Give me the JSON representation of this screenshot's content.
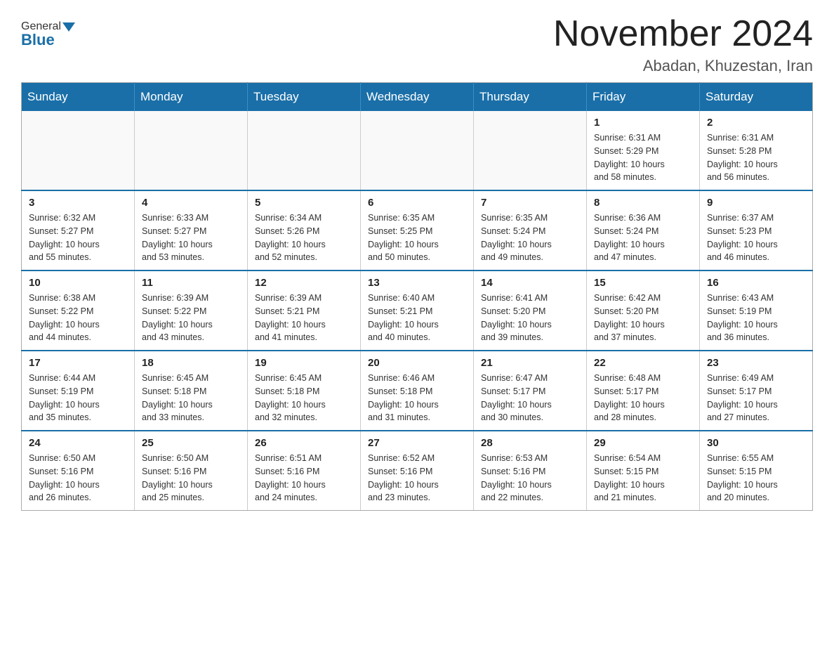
{
  "header": {
    "logo": {
      "general": "General",
      "blue": "Blue"
    },
    "title": "November 2024",
    "location": "Abadan, Khuzestan, Iran"
  },
  "weekdays": [
    "Sunday",
    "Monday",
    "Tuesday",
    "Wednesday",
    "Thursday",
    "Friday",
    "Saturday"
  ],
  "weeks": [
    [
      {
        "day": "",
        "info": ""
      },
      {
        "day": "",
        "info": ""
      },
      {
        "day": "",
        "info": ""
      },
      {
        "day": "",
        "info": ""
      },
      {
        "day": "",
        "info": ""
      },
      {
        "day": "1",
        "info": "Sunrise: 6:31 AM\nSunset: 5:29 PM\nDaylight: 10 hours\nand 58 minutes."
      },
      {
        "day": "2",
        "info": "Sunrise: 6:31 AM\nSunset: 5:28 PM\nDaylight: 10 hours\nand 56 minutes."
      }
    ],
    [
      {
        "day": "3",
        "info": "Sunrise: 6:32 AM\nSunset: 5:27 PM\nDaylight: 10 hours\nand 55 minutes."
      },
      {
        "day": "4",
        "info": "Sunrise: 6:33 AM\nSunset: 5:27 PM\nDaylight: 10 hours\nand 53 minutes."
      },
      {
        "day": "5",
        "info": "Sunrise: 6:34 AM\nSunset: 5:26 PM\nDaylight: 10 hours\nand 52 minutes."
      },
      {
        "day": "6",
        "info": "Sunrise: 6:35 AM\nSunset: 5:25 PM\nDaylight: 10 hours\nand 50 minutes."
      },
      {
        "day": "7",
        "info": "Sunrise: 6:35 AM\nSunset: 5:24 PM\nDaylight: 10 hours\nand 49 minutes."
      },
      {
        "day": "8",
        "info": "Sunrise: 6:36 AM\nSunset: 5:24 PM\nDaylight: 10 hours\nand 47 minutes."
      },
      {
        "day": "9",
        "info": "Sunrise: 6:37 AM\nSunset: 5:23 PM\nDaylight: 10 hours\nand 46 minutes."
      }
    ],
    [
      {
        "day": "10",
        "info": "Sunrise: 6:38 AM\nSunset: 5:22 PM\nDaylight: 10 hours\nand 44 minutes."
      },
      {
        "day": "11",
        "info": "Sunrise: 6:39 AM\nSunset: 5:22 PM\nDaylight: 10 hours\nand 43 minutes."
      },
      {
        "day": "12",
        "info": "Sunrise: 6:39 AM\nSunset: 5:21 PM\nDaylight: 10 hours\nand 41 minutes."
      },
      {
        "day": "13",
        "info": "Sunrise: 6:40 AM\nSunset: 5:21 PM\nDaylight: 10 hours\nand 40 minutes."
      },
      {
        "day": "14",
        "info": "Sunrise: 6:41 AM\nSunset: 5:20 PM\nDaylight: 10 hours\nand 39 minutes."
      },
      {
        "day": "15",
        "info": "Sunrise: 6:42 AM\nSunset: 5:20 PM\nDaylight: 10 hours\nand 37 minutes."
      },
      {
        "day": "16",
        "info": "Sunrise: 6:43 AM\nSunset: 5:19 PM\nDaylight: 10 hours\nand 36 minutes."
      }
    ],
    [
      {
        "day": "17",
        "info": "Sunrise: 6:44 AM\nSunset: 5:19 PM\nDaylight: 10 hours\nand 35 minutes."
      },
      {
        "day": "18",
        "info": "Sunrise: 6:45 AM\nSunset: 5:18 PM\nDaylight: 10 hours\nand 33 minutes."
      },
      {
        "day": "19",
        "info": "Sunrise: 6:45 AM\nSunset: 5:18 PM\nDaylight: 10 hours\nand 32 minutes."
      },
      {
        "day": "20",
        "info": "Sunrise: 6:46 AM\nSunset: 5:18 PM\nDaylight: 10 hours\nand 31 minutes."
      },
      {
        "day": "21",
        "info": "Sunrise: 6:47 AM\nSunset: 5:17 PM\nDaylight: 10 hours\nand 30 minutes."
      },
      {
        "day": "22",
        "info": "Sunrise: 6:48 AM\nSunset: 5:17 PM\nDaylight: 10 hours\nand 28 minutes."
      },
      {
        "day": "23",
        "info": "Sunrise: 6:49 AM\nSunset: 5:17 PM\nDaylight: 10 hours\nand 27 minutes."
      }
    ],
    [
      {
        "day": "24",
        "info": "Sunrise: 6:50 AM\nSunset: 5:16 PM\nDaylight: 10 hours\nand 26 minutes."
      },
      {
        "day": "25",
        "info": "Sunrise: 6:50 AM\nSunset: 5:16 PM\nDaylight: 10 hours\nand 25 minutes."
      },
      {
        "day": "26",
        "info": "Sunrise: 6:51 AM\nSunset: 5:16 PM\nDaylight: 10 hours\nand 24 minutes."
      },
      {
        "day": "27",
        "info": "Sunrise: 6:52 AM\nSunset: 5:16 PM\nDaylight: 10 hours\nand 23 minutes."
      },
      {
        "day": "28",
        "info": "Sunrise: 6:53 AM\nSunset: 5:16 PM\nDaylight: 10 hours\nand 22 minutes."
      },
      {
        "day": "29",
        "info": "Sunrise: 6:54 AM\nSunset: 5:15 PM\nDaylight: 10 hours\nand 21 minutes."
      },
      {
        "day": "30",
        "info": "Sunrise: 6:55 AM\nSunset: 5:15 PM\nDaylight: 10 hours\nand 20 minutes."
      }
    ]
  ]
}
